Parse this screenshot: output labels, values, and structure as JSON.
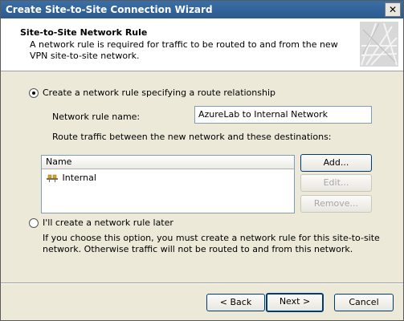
{
  "window": {
    "title": "Create Site-to-Site Connection Wizard",
    "close_glyph": "✕"
  },
  "header": {
    "title": "Site-to-Site Network Rule",
    "description": "A network rule is required for traffic to be routed to and from the new VPN site-to-site network."
  },
  "options": {
    "create_rule_label": "Create a network rule specifying a route relationship",
    "create_rule_selected": true,
    "rule_name_label": "Network rule name:",
    "rule_name_value": "AzureLab to Internal Network",
    "route_label": "Route traffic between the new network and these destinations:",
    "later_label": "I'll create a network rule later",
    "later_selected": false,
    "later_description": "If you choose this option, you must create a network rule for this site-to-site network. Otherwise traffic will not be routed to and from this network."
  },
  "destinations": {
    "column_header": "Name",
    "items": [
      {
        "label": "Internal",
        "icon": "network-icon"
      }
    ]
  },
  "side_buttons": {
    "add": "Add...",
    "edit": "Edit...",
    "remove": "Remove..."
  },
  "footer": {
    "back": "< Back",
    "next": "Next >",
    "cancel": "Cancel"
  },
  "colors": {
    "title_bar": "#2b5a8e",
    "dialog_bg": "#ece9d8",
    "header_bg": "#ffffff",
    "button_border": "#003c74"
  }
}
